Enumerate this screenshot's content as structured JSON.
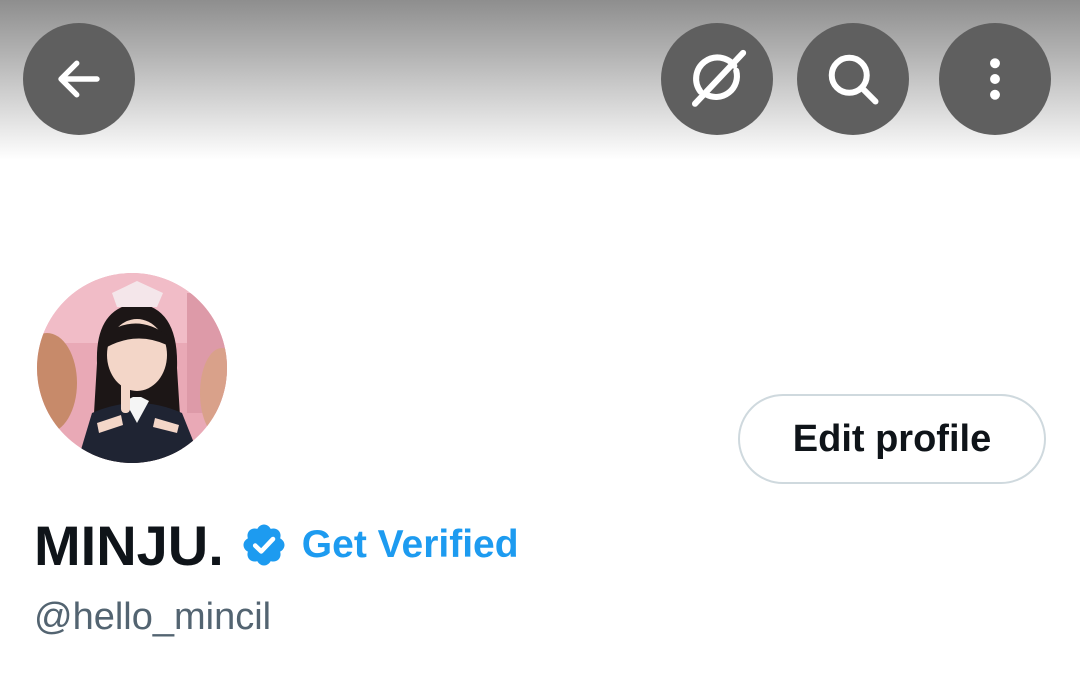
{
  "header": {
    "back_icon": "arrow-left-icon",
    "grok_icon": "grok-icon",
    "search_icon": "search-icon",
    "more_icon": "more-vertical-icon",
    "button_color": "#5f5f5f"
  },
  "profile": {
    "display_name": "MINJU.",
    "verified_icon": "verified-badge-icon",
    "get_verified_label": "Get Verified",
    "handle": "@hello_mincil",
    "edit_profile_label": "Edit profile",
    "accent_color": "#1d9bf0"
  }
}
